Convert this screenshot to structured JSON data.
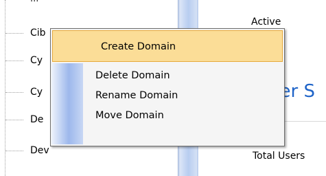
{
  "tree": {
    "top_partial": "...",
    "items": [
      {
        "label": "Cib"
      },
      {
        "label": "Cy"
      },
      {
        "label": "Cy"
      },
      {
        "label": "De"
      },
      {
        "label": "Dev"
      }
    ]
  },
  "details": {
    "status": "Active",
    "heading_fragment": "ser S",
    "total_users_label": "Total Users"
  },
  "context_menu": {
    "items": [
      {
        "label": "Create Domain",
        "highlighted": true
      },
      {
        "label": "Delete Domain"
      },
      {
        "label": "Rename Domain"
      },
      {
        "label": "Move Domain"
      }
    ]
  },
  "colors": {
    "menu_highlight": "#fbdd97",
    "menu_highlight_border": "#e6a93b",
    "heading": "#1f64c8",
    "splitter": "#a9c0ea"
  }
}
